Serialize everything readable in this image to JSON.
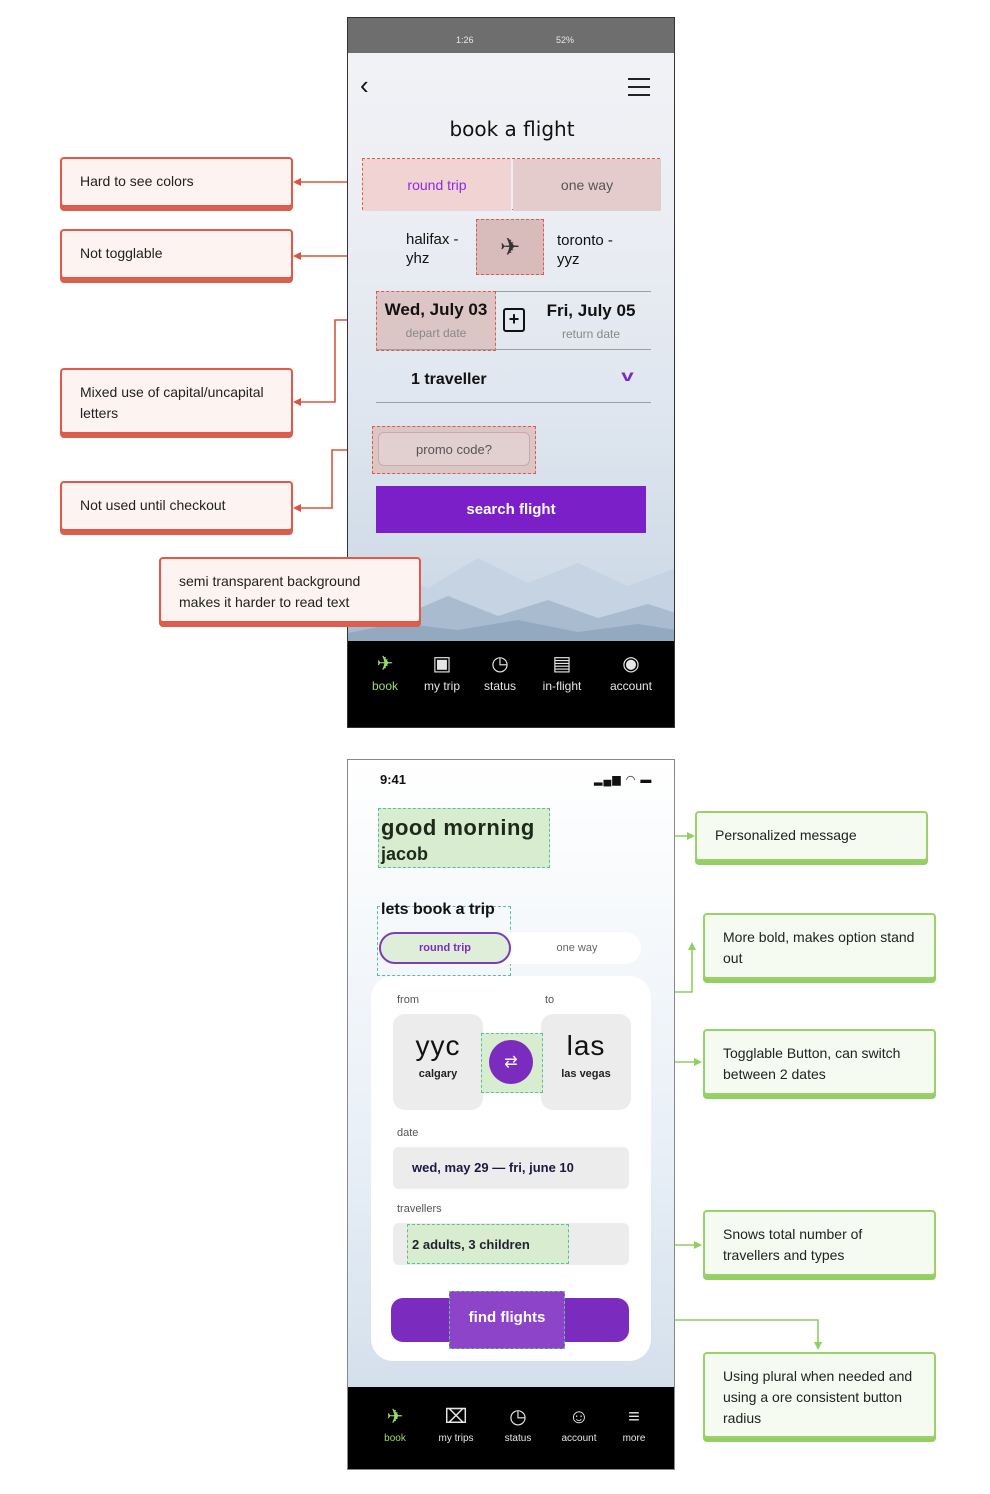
{
  "phone_old": {
    "status_time": "1:26",
    "status_right": "52%",
    "title": "book a flight",
    "trip_toggle": [
      "round trip",
      "one way"
    ],
    "from_line1": "halifax -",
    "from_line2": "yhz",
    "to_line1": "toronto -",
    "to_line2": "yyz",
    "depart_date": "Wed, July 03",
    "depart_label": "depart date",
    "return_date": "Fri, July 05",
    "return_label": "return date",
    "travellers": "1 traveller",
    "promo_placeholder": "promo code?",
    "search_button": "search flight",
    "nav": [
      "book",
      "my trip",
      "status",
      "in-flight",
      "account"
    ]
  },
  "phone_new": {
    "status_time": "9:41",
    "greeting_line1": "good morning",
    "greeting_line2": "jacob",
    "subtitle": "lets book a trip",
    "trip_toggle": [
      "round trip",
      "one way"
    ],
    "from_label": "from",
    "to_label": "to",
    "from_code": "yyc",
    "from_city": "calgary",
    "to_code": "las",
    "to_city": "las vegas",
    "date_label": "date",
    "date_from": "wed, may 29",
    "date_to": "fri, june 10",
    "travellers_label": "travellers",
    "travellers_value": "2 adults, 3 children",
    "find_button": "find flights",
    "nav": [
      "book",
      "my trips",
      "status",
      "account",
      "more"
    ]
  },
  "callouts_old": [
    "Hard to see colors",
    "Not togglable",
    "Mixed use of capital/uncapital letters",
    "Not used until checkout",
    "semi transparent background makes it harder to read text"
  ],
  "callouts_new": [
    "Personalized message",
    "More bold, makes option stand out",
    "Togglable Button, can switch between 2 dates",
    "Snows total number of travellers and types",
    "Using plural when needed and using a ore consistent button radius"
  ],
  "colors": {
    "bad_accent": "#e4574a",
    "good_accent": "#9ad16a",
    "brand_purple": "#7b2cbf",
    "active_nav": "#9bdb6b"
  }
}
